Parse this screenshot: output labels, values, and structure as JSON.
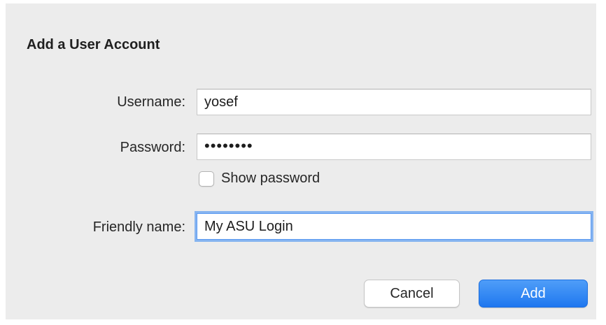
{
  "dialog": {
    "title": "Add a User Account",
    "username": {
      "label": "Username:",
      "value": "yosef"
    },
    "password": {
      "label": "Password:",
      "masked_value": "••••••••"
    },
    "show_password": {
      "label": "Show password",
      "checked": false
    },
    "friendly_name": {
      "label": "Friendly name:",
      "value": "My ASU Login"
    },
    "buttons": {
      "cancel": "Cancel",
      "add": "Add"
    }
  },
  "colors": {
    "dialog_background": "#ececec",
    "primary_button": "#1f77ef",
    "focus_ring": "#86b4f0"
  }
}
